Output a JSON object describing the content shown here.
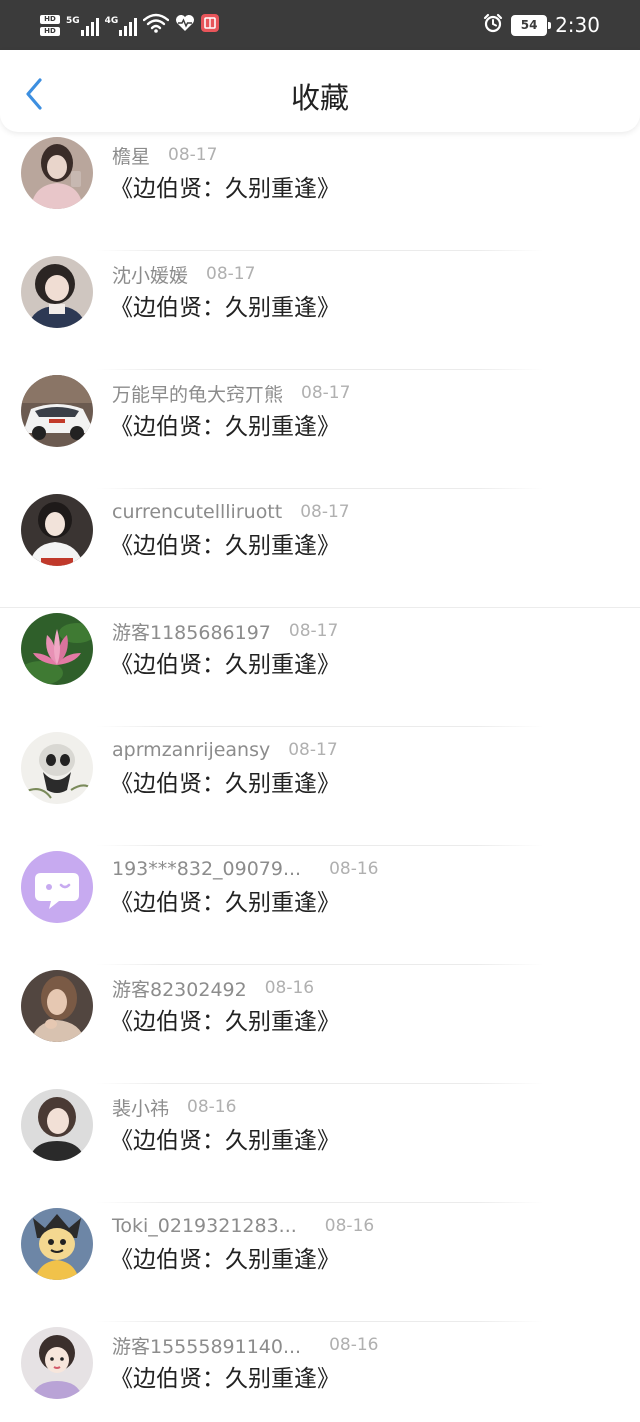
{
  "status_bar": {
    "hd_top": "HD",
    "hd_bottom": "HD",
    "net1": "5G",
    "net2": "4G",
    "battery": "54",
    "time": "2:30",
    "icons": [
      "signal-icon",
      "wifi-icon",
      "heart-icon",
      "app-icon",
      "alarm-icon",
      "battery-icon"
    ]
  },
  "header": {
    "title": "收藏",
    "back_icon": "chevron-left-icon",
    "accent_color": "#3d8fe0"
  },
  "items": [
    {
      "name": "檐星",
      "date": "08-17",
      "title": "《边伯贤：久别重逢》"
    },
    {
      "name": "沈小媛媛",
      "date": "08-17",
      "title": "《边伯贤：久别重逢》"
    },
    {
      "name": "万能早的龟大窍丌熊",
      "date": "08-17",
      "title": "《边伯贤：久别重逢》"
    },
    {
      "name": "currencutellliruott",
      "date": "08-17",
      "title": "《边伯贤：久别重逢》"
    },
    {
      "name": "游客1185686197",
      "date": "08-17",
      "title": "《边伯贤：久别重逢》"
    },
    {
      "name": "aprmzanrijeansy",
      "date": "08-17",
      "title": "《边伯贤：久别重逢》"
    },
    {
      "name": "193***832_09079...",
      "date": "08-16",
      "title": "《边伯贤：久别重逢》"
    },
    {
      "name": "游客82302492",
      "date": "08-16",
      "title": "《边伯贤：久别重逢》"
    },
    {
      "name": "裴小祎",
      "date": "08-16",
      "title": "《边伯贤：久别重逢》"
    },
    {
      "name": "Toki_0219321283...",
      "date": "08-16",
      "title": "《边伯贤：久别重逢》"
    },
    {
      "name": "游客15555891140...",
      "date": "08-16",
      "title": "《边伯贤：久别重逢》"
    }
  ]
}
